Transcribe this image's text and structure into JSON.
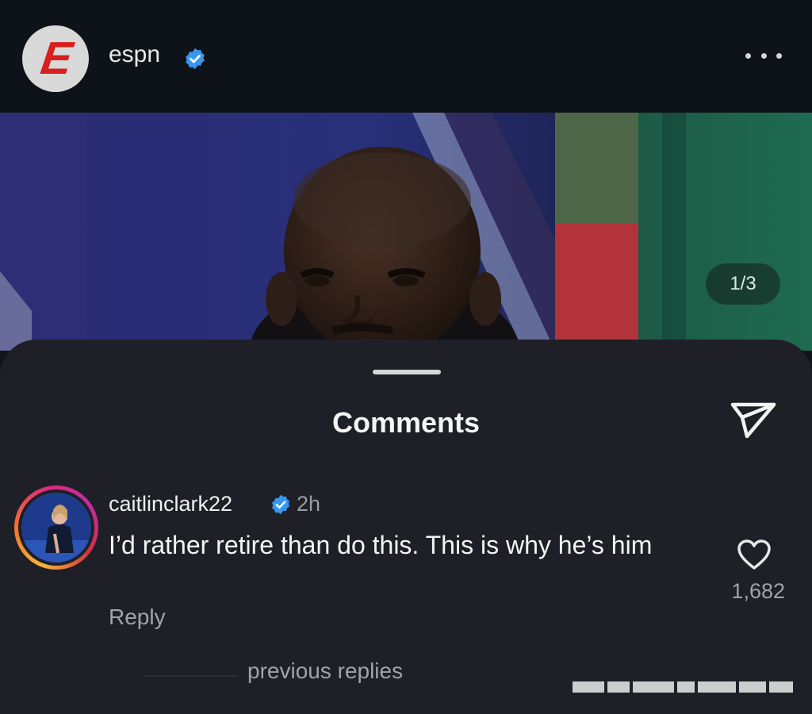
{
  "post": {
    "account": "espn",
    "verified": true,
    "page_indicator": "1/3",
    "icons": {
      "avatar_letter": "E",
      "verified": "verified-badge-icon",
      "more": "more-options-icon"
    },
    "colors": {
      "espn_red": "#d8201f",
      "verified_blue": "#3897f0"
    }
  },
  "comments_sheet": {
    "title": "Comments",
    "icons": {
      "share": "send-share-icon",
      "like": "heart-icon"
    },
    "comment": {
      "username": "caitlinclark22",
      "verified": true,
      "time": "2h",
      "text": "I’d rather retire than do this. This is why he’s him",
      "reply_label": "Reply",
      "like_count": "1,682"
    },
    "previous_replies_label": "previous replies"
  }
}
